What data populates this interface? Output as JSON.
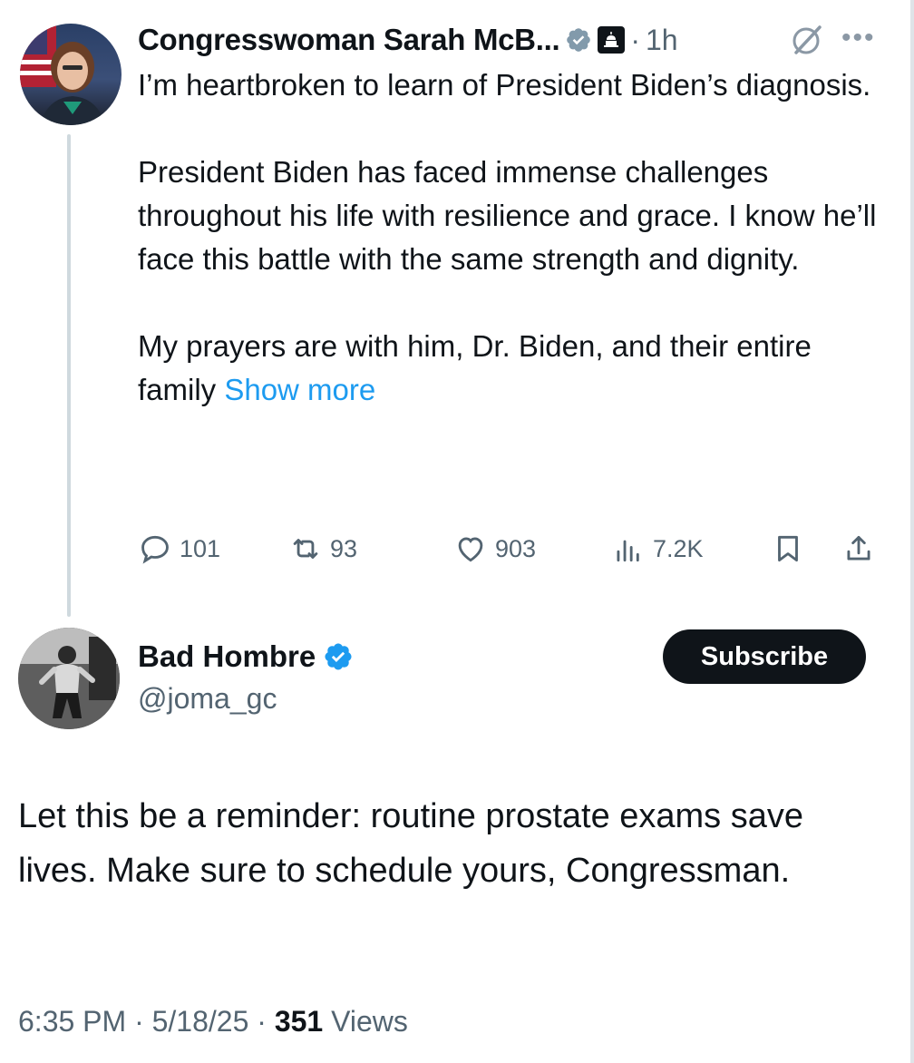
{
  "quoted_post": {
    "display_name": "Congresswoman Sarah McB...",
    "time": "1h",
    "separator": "·",
    "body": "I’m heartbroken to learn of President Biden’s diagnosis.\n\nPresident Biden has faced immense challenges throughout his life with resilience and grace. I know he’ll face this battle with the same strength and dignity.\n\nMy prayers are with him, Dr. Biden, and their entire family ",
    "show_more": "Show more",
    "replies": "101",
    "reposts": "93",
    "likes": "903",
    "views": "7.2K"
  },
  "main_post": {
    "display_name": "Bad Hombre",
    "handle": "@joma_gc",
    "subscribe_label": "Subscribe",
    "body": "Let this be a reminder: routine prostate exams save lives. Make sure to schedule yours, Congressman.",
    "time": "6:35 PM",
    "date": "5/18/25",
    "sep": "·",
    "views_count": "351",
    "views_label": "Views"
  },
  "colors": {
    "accent": "#1d9bf0",
    "muted": "#536471",
    "text": "#0f1419",
    "verified_grey": "#829aab",
    "thread_line": "#cfd9de"
  },
  "icons": [
    "verified-grey-icon",
    "government-tag-icon",
    "grok-icon",
    "more-icon",
    "reply-icon",
    "repost-icon",
    "like-icon",
    "views-icon",
    "bookmark-icon",
    "share-icon",
    "verified-blue-icon"
  ]
}
